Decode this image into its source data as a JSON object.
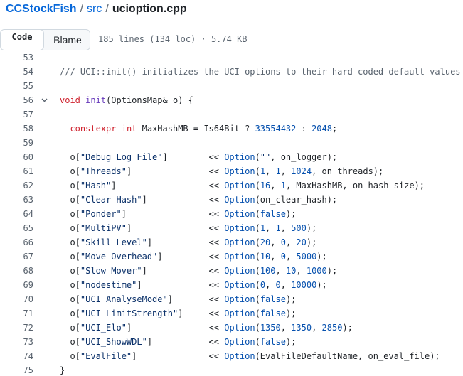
{
  "breadcrumb": {
    "repo": "CCStockFish",
    "sep1": "/",
    "dir": "src",
    "sep2": "/",
    "file": "ucioption.cpp"
  },
  "toolbar": {
    "code_label": "Code",
    "blame_label": "Blame",
    "file_info": "185 lines (134 loc) · 5.74 KB"
  },
  "code": {
    "lines": [
      {
        "n": "53",
        "tokens": []
      },
      {
        "n": "54",
        "tokens": [
          {
            "t": "/// UCI::init() initializes the UCI options to their hard-coded default values",
            "c": "cm"
          }
        ]
      },
      {
        "n": "55",
        "tokens": []
      },
      {
        "n": "56",
        "fold": true,
        "tokens": [
          {
            "t": "void",
            "c": "kw"
          },
          {
            "t": " "
          },
          {
            "t": "init",
            "c": "fn"
          },
          {
            "t": "(OptionsMap& o) {"
          }
        ]
      },
      {
        "n": "57",
        "tokens": []
      },
      {
        "n": "58",
        "tokens": [
          {
            "t": "  "
          },
          {
            "t": "constexpr",
            "c": "kw"
          },
          {
            "t": " "
          },
          {
            "t": "int",
            "c": "kw"
          },
          {
            "t": " MaxHashMB = Is64Bit ? "
          },
          {
            "t": "33554432",
            "c": "nm"
          },
          {
            "t": " : "
          },
          {
            "t": "2048",
            "c": "nm"
          },
          {
            "t": ";"
          }
        ]
      },
      {
        "n": "59",
        "tokens": []
      },
      {
        "n": "60",
        "tokens": [
          {
            "t": "  o["
          },
          {
            "t": "\"Debug Log File\"",
            "c": "st"
          },
          {
            "t": "]        << "
          },
          {
            "t": "Option",
            "c": "ty"
          },
          {
            "t": "("
          },
          {
            "t": "\"\"",
            "c": "st"
          },
          {
            "t": ", on_logger);"
          }
        ]
      },
      {
        "n": "61",
        "tokens": [
          {
            "t": "  o["
          },
          {
            "t": "\"Threads\"",
            "c": "st"
          },
          {
            "t": "]               << "
          },
          {
            "t": "Option",
            "c": "ty"
          },
          {
            "t": "("
          },
          {
            "t": "1",
            "c": "nm"
          },
          {
            "t": ", "
          },
          {
            "t": "1",
            "c": "nm"
          },
          {
            "t": ", "
          },
          {
            "t": "1024",
            "c": "nm"
          },
          {
            "t": ", on_threads);"
          }
        ]
      },
      {
        "n": "62",
        "tokens": [
          {
            "t": "  o["
          },
          {
            "t": "\"Hash\"",
            "c": "st"
          },
          {
            "t": "]                  << "
          },
          {
            "t": "Option",
            "c": "ty"
          },
          {
            "t": "("
          },
          {
            "t": "16",
            "c": "nm"
          },
          {
            "t": ", "
          },
          {
            "t": "1",
            "c": "nm"
          },
          {
            "t": ", MaxHashMB, on_hash_size);"
          }
        ]
      },
      {
        "n": "63",
        "tokens": [
          {
            "t": "  o["
          },
          {
            "t": "\"Clear Hash\"",
            "c": "st"
          },
          {
            "t": "]            << "
          },
          {
            "t": "Option",
            "c": "ty"
          },
          {
            "t": "(on_clear_hash);"
          }
        ]
      },
      {
        "n": "64",
        "tokens": [
          {
            "t": "  o["
          },
          {
            "t": "\"Ponder\"",
            "c": "st"
          },
          {
            "t": "]                << "
          },
          {
            "t": "Option",
            "c": "ty"
          },
          {
            "t": "("
          },
          {
            "t": "false",
            "c": "nm"
          },
          {
            "t": ");"
          }
        ]
      },
      {
        "n": "65",
        "tokens": [
          {
            "t": "  o["
          },
          {
            "t": "\"MultiPV\"",
            "c": "st"
          },
          {
            "t": "]               << "
          },
          {
            "t": "Option",
            "c": "ty"
          },
          {
            "t": "("
          },
          {
            "t": "1",
            "c": "nm"
          },
          {
            "t": ", "
          },
          {
            "t": "1",
            "c": "nm"
          },
          {
            "t": ", "
          },
          {
            "t": "500",
            "c": "nm"
          },
          {
            "t": ");"
          }
        ]
      },
      {
        "n": "66",
        "tokens": [
          {
            "t": "  o["
          },
          {
            "t": "\"Skill Level\"",
            "c": "st"
          },
          {
            "t": "]           << "
          },
          {
            "t": "Option",
            "c": "ty"
          },
          {
            "t": "("
          },
          {
            "t": "20",
            "c": "nm"
          },
          {
            "t": ", "
          },
          {
            "t": "0",
            "c": "nm"
          },
          {
            "t": ", "
          },
          {
            "t": "20",
            "c": "nm"
          },
          {
            "t": ");"
          }
        ]
      },
      {
        "n": "67",
        "tokens": [
          {
            "t": "  o["
          },
          {
            "t": "\"Move Overhead\"",
            "c": "st"
          },
          {
            "t": "]         << "
          },
          {
            "t": "Option",
            "c": "ty"
          },
          {
            "t": "("
          },
          {
            "t": "10",
            "c": "nm"
          },
          {
            "t": ", "
          },
          {
            "t": "0",
            "c": "nm"
          },
          {
            "t": ", "
          },
          {
            "t": "5000",
            "c": "nm"
          },
          {
            "t": ");"
          }
        ]
      },
      {
        "n": "68",
        "tokens": [
          {
            "t": "  o["
          },
          {
            "t": "\"Slow Mover\"",
            "c": "st"
          },
          {
            "t": "]            << "
          },
          {
            "t": "Option",
            "c": "ty"
          },
          {
            "t": "("
          },
          {
            "t": "100",
            "c": "nm"
          },
          {
            "t": ", "
          },
          {
            "t": "10",
            "c": "nm"
          },
          {
            "t": ", "
          },
          {
            "t": "1000",
            "c": "nm"
          },
          {
            "t": ");"
          }
        ]
      },
      {
        "n": "69",
        "tokens": [
          {
            "t": "  o["
          },
          {
            "t": "\"nodestime\"",
            "c": "st"
          },
          {
            "t": "]             << "
          },
          {
            "t": "Option",
            "c": "ty"
          },
          {
            "t": "("
          },
          {
            "t": "0",
            "c": "nm"
          },
          {
            "t": ", "
          },
          {
            "t": "0",
            "c": "nm"
          },
          {
            "t": ", "
          },
          {
            "t": "10000",
            "c": "nm"
          },
          {
            "t": ");"
          }
        ]
      },
      {
        "n": "70",
        "tokens": [
          {
            "t": "  o["
          },
          {
            "t": "\"UCI_AnalyseMode\"",
            "c": "st"
          },
          {
            "t": "]       << "
          },
          {
            "t": "Option",
            "c": "ty"
          },
          {
            "t": "("
          },
          {
            "t": "false",
            "c": "nm"
          },
          {
            "t": ");"
          }
        ]
      },
      {
        "n": "71",
        "tokens": [
          {
            "t": "  o["
          },
          {
            "t": "\"UCI_LimitStrength\"",
            "c": "st"
          },
          {
            "t": "]     << "
          },
          {
            "t": "Option",
            "c": "ty"
          },
          {
            "t": "("
          },
          {
            "t": "false",
            "c": "nm"
          },
          {
            "t": ");"
          }
        ]
      },
      {
        "n": "72",
        "tokens": [
          {
            "t": "  o["
          },
          {
            "t": "\"UCI_Elo\"",
            "c": "st"
          },
          {
            "t": "]               << "
          },
          {
            "t": "Option",
            "c": "ty"
          },
          {
            "t": "("
          },
          {
            "t": "1350",
            "c": "nm"
          },
          {
            "t": ", "
          },
          {
            "t": "1350",
            "c": "nm"
          },
          {
            "t": ", "
          },
          {
            "t": "2850",
            "c": "nm"
          },
          {
            "t": ");"
          }
        ]
      },
      {
        "n": "73",
        "tokens": [
          {
            "t": "  o["
          },
          {
            "t": "\"UCI_ShowWDL\"",
            "c": "st"
          },
          {
            "t": "]           << "
          },
          {
            "t": "Option",
            "c": "ty"
          },
          {
            "t": "("
          },
          {
            "t": "false",
            "c": "nm"
          },
          {
            "t": ");"
          }
        ]
      },
      {
        "n": "74",
        "tokens": [
          {
            "t": "  o["
          },
          {
            "t": "\"EvalFile\"",
            "c": "st"
          },
          {
            "t": "]              << "
          },
          {
            "t": "Option",
            "c": "ty"
          },
          {
            "t": "(EvalFileDefaultName, on_eval_file);"
          }
        ]
      },
      {
        "n": "75",
        "tokens": [
          {
            "t": "}"
          }
        ]
      }
    ]
  }
}
